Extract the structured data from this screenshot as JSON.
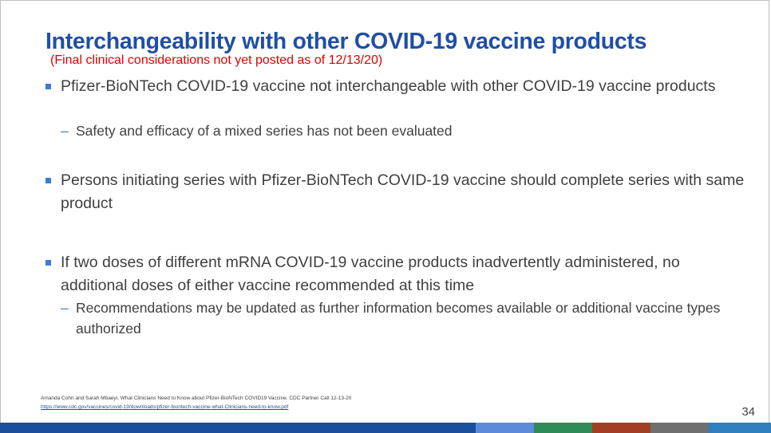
{
  "slide": {
    "title": "Interchangeability with other COVID-19 vaccine products",
    "subtitle": "(Final clinical considerations not yet posted as of 12/13/20)",
    "bullets": [
      {
        "text": "Pfizer-BioNTech COVID-19 vaccine not interchangeable with other COVID-19 vaccine products",
        "sub": [
          "Safety and efficacy of a mixed series has not been evaluated"
        ]
      },
      {
        "text": "Persons initiating series with Pfizer-BioNTech COVID-19 vaccine should complete series with same product",
        "sub": []
      },
      {
        "text": "If two doses of different mRNA COVID-19 vaccine products inadvertently administered, no additional doses of either vaccine recommended at this time",
        "sub": [
          "Recommendations may be updated as further information becomes available or additional vaccine types authorized"
        ]
      }
    ],
    "sub_marker": "–",
    "citation": "Amanda Cohn and Sarah Mbaeyi.  What Clinicians Need to Know about Pfizer-BioNTech COVID19 Vaccine. CDC Partner Call 12-13-20",
    "citation_url": "https://www.cdc.gov/vaccines/covid-19/downloads/pfizer-biontech-vaccine-what-Clinicians-need-to-know.pdf",
    "page_number": "34"
  },
  "colors": {
    "title": "#1f4fa6",
    "subtitle": "#e00000",
    "bullet_marker": "#3a7bd5",
    "bottom_bar": "#1b4f9c",
    "bar_segments": [
      "#5b8bd9",
      "#2e8b57",
      "#a23e24",
      "#6f6f6f",
      "#2f7fbf"
    ]
  }
}
